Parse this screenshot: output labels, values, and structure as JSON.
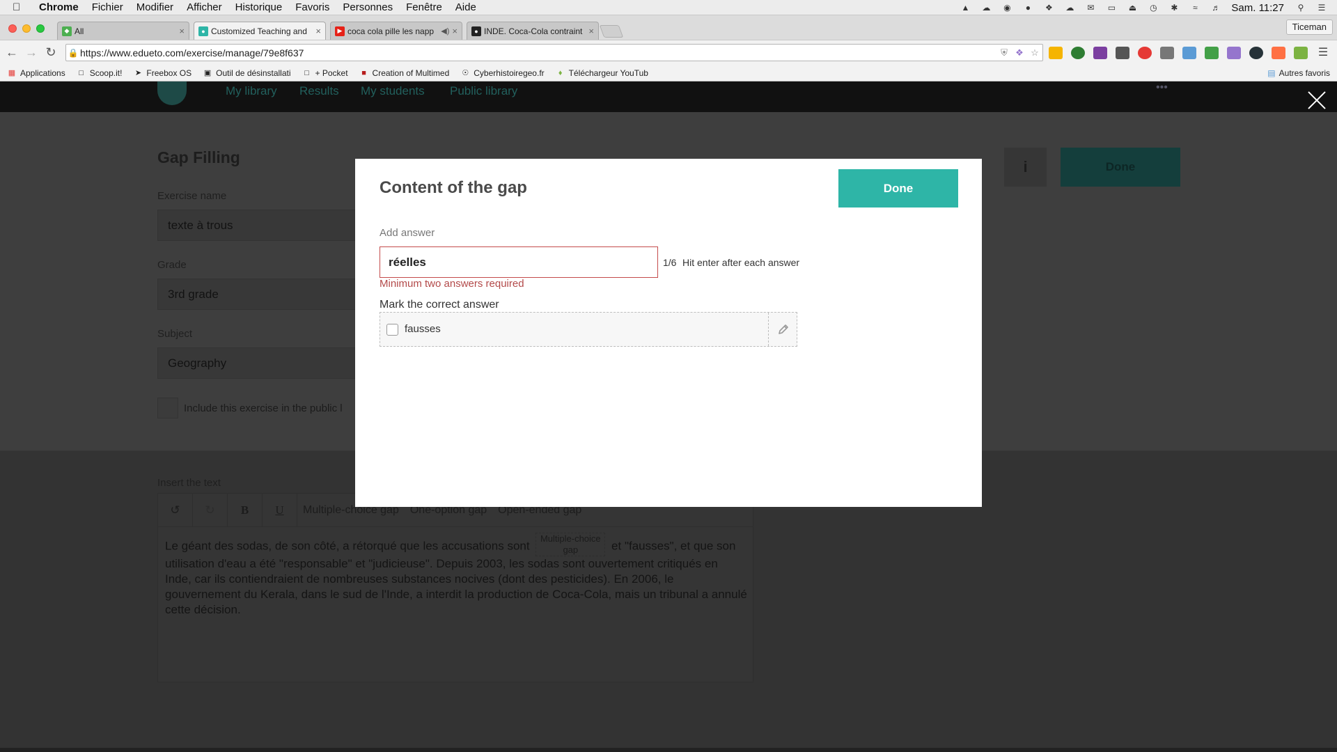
{
  "menubar": {
    "app_name": "Chrome",
    "items": [
      "Fichier",
      "Modifier",
      "Afficher",
      "Historique",
      "Favoris",
      "Personnes",
      "Fenêtre",
      "Aide"
    ],
    "clock": "Sam. 11:27"
  },
  "tabs": [
    {
      "title": "All",
      "favicon_color": "#4caf50",
      "active": false
    },
    {
      "title": "Customized Teaching and",
      "favicon_color": "#2eb5a7",
      "active": true
    },
    {
      "title": "coca cola pille les napp",
      "favicon_color": "#e62117",
      "active": false
    },
    {
      "title": "INDE. Coca-Cola contraint",
      "favicon_color": "#222222",
      "active": false
    }
  ],
  "profile_name": "Ticeman",
  "address_bar": {
    "url": "https://www.edueto.com/exercise/manage/79e8f637"
  },
  "bookmarks": [
    {
      "label": "Applications",
      "icon": "grid-icon"
    },
    {
      "label": "Scoop.it!",
      "icon": "page-icon"
    },
    {
      "label": "Freebox OS",
      "icon": "bookmark-icon"
    },
    {
      "label": "Outil de désinstallati",
      "icon": "tool-icon"
    },
    {
      "label": "+ Pocket",
      "icon": "page-icon"
    },
    {
      "label": "Creation of Multimed",
      "icon": "film-icon"
    },
    {
      "label": "Cyberhistoiregeo.fr",
      "icon": "globe-icon"
    },
    {
      "label": "Téléchargeur YouTub",
      "icon": "download-icon"
    }
  ],
  "bookmarks_other": "Autres favoris",
  "app_nav": {
    "links": [
      "My library",
      "Results",
      "My students",
      "Public library"
    ],
    "dots": "•••"
  },
  "exercise": {
    "title": "Gap Filling",
    "name_label": "Exercise name",
    "name_value": "texte à trous",
    "grade_label": "Grade",
    "grade_value": "3rd grade",
    "subject_label": "Subject",
    "subject_value": "Geography",
    "public_label": "Include this exercise in the public l",
    "info_glyph": "i",
    "done_label": "Done",
    "insert_label": "Insert the text",
    "editor_toolbar": {
      "bold": "B",
      "underline": "U",
      "multiple_choice": "Multiple-choice gap",
      "one_option": "One-option gap",
      "open_ended": "Open-ended gap"
    },
    "text_before": "Le géant des sodas, de son côté, a rétorqué que les accusations sont",
    "gap_chip": "Multiple-choice gap",
    "text_after": "et \"fausses\", et que son utilisation d'eau a été \"responsable\" et \"judicieuse\". Depuis 2003, les sodas sont ouvertement critiqués en Inde, car ils contiendraient de nombreuses substances nocives (dont des pesticides). En 2006, le gouvernement du Kerala, dans le sud de l'Inde, a interdit la production de Coca-Cola, mais un tribunal a annulé cette décision."
  },
  "modal": {
    "title": "Content of the gap",
    "done_label": "Done",
    "add_answer_label": "Add answer",
    "input_value": "réelles",
    "count": "1/6",
    "hint": "Hit enter after each answer",
    "error": "Minimum two answers required",
    "mark_label": "Mark the correct answer",
    "answers": [
      {
        "text": "fausses",
        "checked": false
      }
    ]
  },
  "colors": {
    "accent": "#2eb5a7",
    "error": "#b34a4a",
    "overlay": "#3e3e3e"
  }
}
